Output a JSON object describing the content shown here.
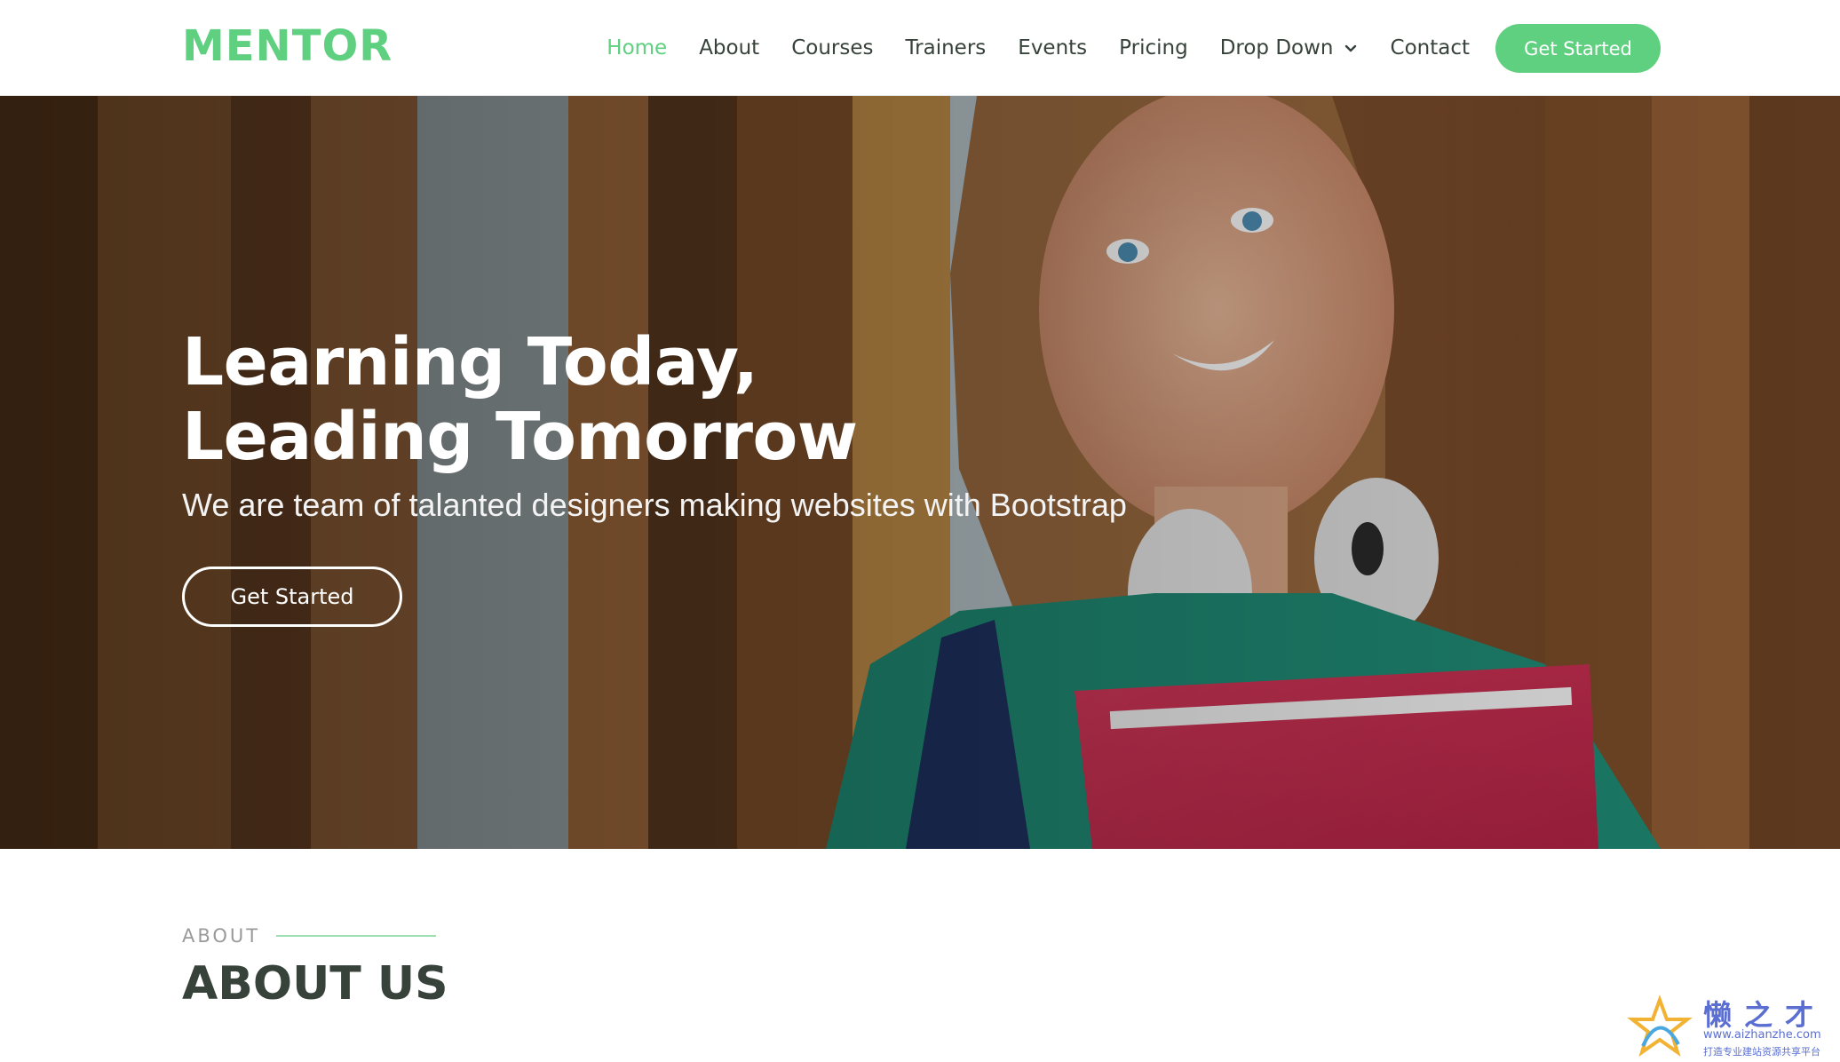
{
  "brand": {
    "logo": "MENTOR",
    "accent": "#5fcf80",
    "text_dark": "#37423b"
  },
  "nav": {
    "items": [
      {
        "label": "Home",
        "active": true
      },
      {
        "label": "About",
        "active": false
      },
      {
        "label": "Courses",
        "active": false
      },
      {
        "label": "Trainers",
        "active": false
      },
      {
        "label": "Events",
        "active": false
      },
      {
        "label": "Pricing",
        "active": false
      },
      {
        "label": "Drop Down",
        "active": false,
        "icon": "chevron-down-icon"
      },
      {
        "label": "Contact",
        "active": false
      }
    ],
    "cta": "Get Started"
  },
  "hero": {
    "title_line1": "Learning Today,",
    "title_line2": "Leading Tomorrow",
    "subtitle": "We are team of talanted designers making websites with Bootstrap",
    "button": "Get Started",
    "image": "student-with-headphones-and-red-folder"
  },
  "about": {
    "kicker": "ABOUT",
    "title": "ABOUT US"
  },
  "watermark": {
    "cn": "懒之才",
    "url": "www.aizhanzhe.com",
    "tagline": "打造专业建站资源共享平台"
  }
}
